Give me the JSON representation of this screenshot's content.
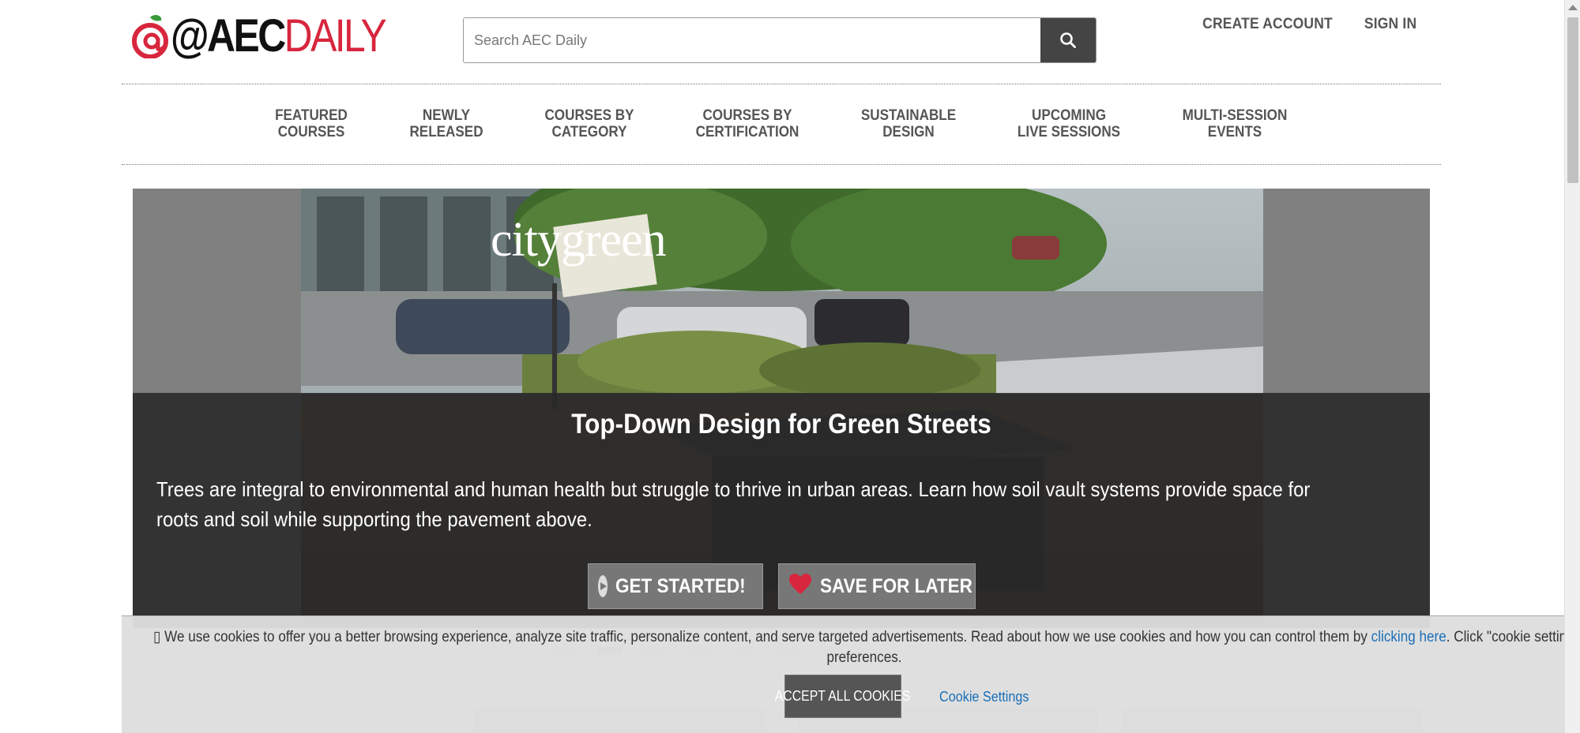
{
  "header": {
    "logo_text_primary": "@AEC",
    "logo_text_secondary": "DAILY",
    "search_placeholder": "Search AEC Daily",
    "create_account": "CREATE ACCOUNT",
    "sign_in": "SIGN IN"
  },
  "nav": {
    "items": [
      {
        "line1": "FEATURED",
        "line2": "COURSES"
      },
      {
        "line1": "NEWLY",
        "line2": "RELEASED"
      },
      {
        "line1": "COURSES BY",
        "line2": "CATEGORY"
      },
      {
        "line1": "COURSES BY",
        "line2": "CERTIFICATION"
      },
      {
        "line1": "SUSTAINABLE",
        "line2": "DESIGN"
      },
      {
        "line1": "UPCOMING",
        "line2": "LIVE SESSIONS"
      },
      {
        "line1": "MULTI-SESSION",
        "line2": "EVENTS"
      }
    ]
  },
  "hero": {
    "brand": "citygreen",
    "title": "Top-Down Design for Green Streets",
    "description": "Trees are integral to environmental and human health but struggle to thrive in urban areas. Learn how soil vault systems provide space for roots and soil while supporting the pavement above.",
    "get_started": "GET STARTED!",
    "save_for_later": "SAVE FOR LATER"
  },
  "cookie": {
    "icon": "info-icon",
    "text_before_link": "We use cookies to offer you a better browsing experience, analyze site traffic, personalize content, and serve targeted advertisements. Read about how we use cookies and how you can control them by ",
    "link_text": "clicking here",
    "text_after_link": ". Click \"cookie settings\" to",
    "text_line2": "preferences.",
    "accept_all": "ACCEPT ALL COOKIES",
    "settings": "Cookie Settings"
  },
  "colors": {
    "brand_red": "#d7263d",
    "nav_text": "#555555",
    "link_blue": "#1a6fb8",
    "overlay": "#282828"
  }
}
